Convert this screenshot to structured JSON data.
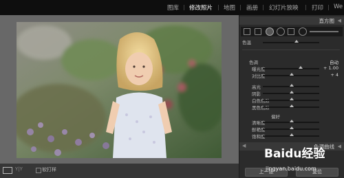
{
  "modules": [
    "图库",
    "修改照片",
    "地图",
    "画册",
    "幻灯片放映",
    "打印",
    "We"
  ],
  "active_module": "修改照片",
  "panel": {
    "histogram_title": "直方图",
    "tone": {
      "tone_label": "色调",
      "auto_label": "自动",
      "exposure_label": "曝光度",
      "exposure_value": "+ 1.00",
      "contrast_label": "对比度",
      "contrast_value": "+ 4",
      "highlights_label": "高光",
      "shadows_label": "阴影",
      "whites_label": "白色色阶",
      "blacks_label": "黑色色阶"
    },
    "presence": {
      "label": "偏好",
      "clarity_label": "清晰度",
      "vibrance_label": "鲜艳度",
      "saturation_label": "饱和度"
    },
    "tone_curve_label": "色调曲线",
    "partial_label": "色温",
    "bottom_buttons": [
      "上一张",
      "复位"
    ]
  },
  "toolbar": {
    "proof_label": "软打样",
    "xy_label": "Y|Y"
  },
  "watermark": {
    "brand": "Baidu经验",
    "url": "jingyan.baidu.com"
  }
}
